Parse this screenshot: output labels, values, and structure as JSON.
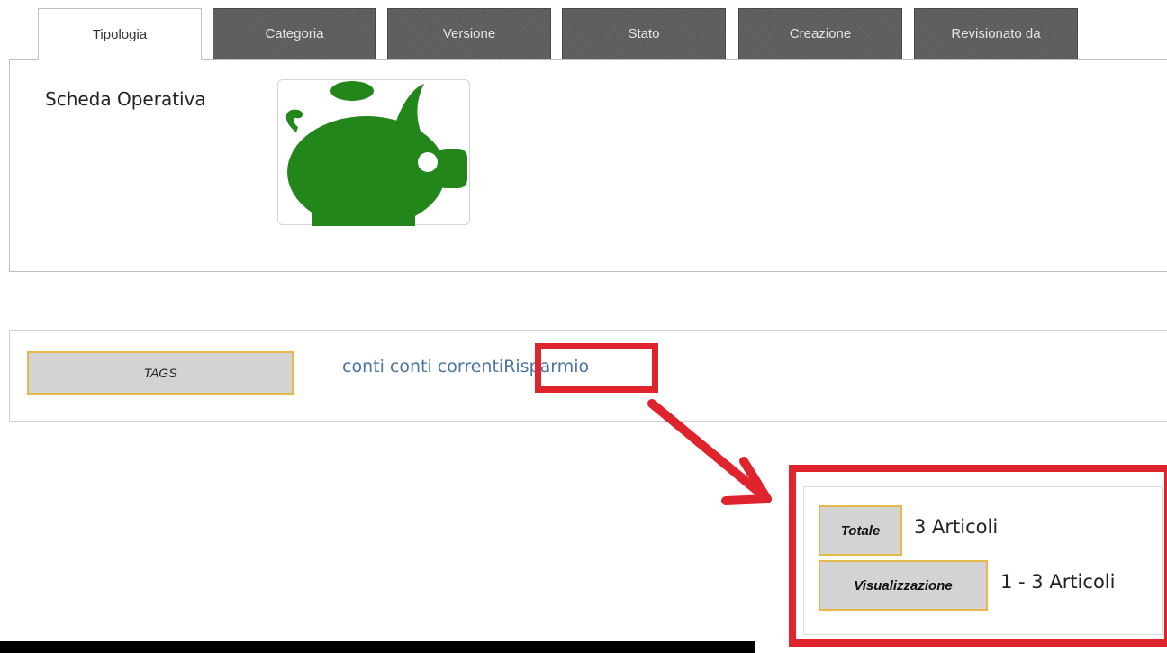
{
  "tabs": [
    {
      "label": "Tipologia",
      "active": true
    },
    {
      "label": "Categoria",
      "active": false
    },
    {
      "label": "Versione",
      "active": false
    },
    {
      "label": "Stato",
      "active": false
    },
    {
      "label": "Creazione",
      "active": false
    },
    {
      "label": "Revisionato da",
      "active": false
    }
  ],
  "type": {
    "label": "Scheda Operativa",
    "icon": "piggy-bank-icon",
    "icon_color": "#22861b"
  },
  "tags": {
    "label": "TAGS",
    "items": [
      "conti",
      "conti correnti",
      "Risparmio"
    ],
    "link_color": "#4a74a6"
  },
  "results": {
    "total_label": "Totale",
    "total_value": "3 Articoli",
    "display_label": "Visualizzazione",
    "display_value": "1 - 3 Articoli"
  },
  "annotations": {
    "highlight_color": "#e0242d"
  }
}
